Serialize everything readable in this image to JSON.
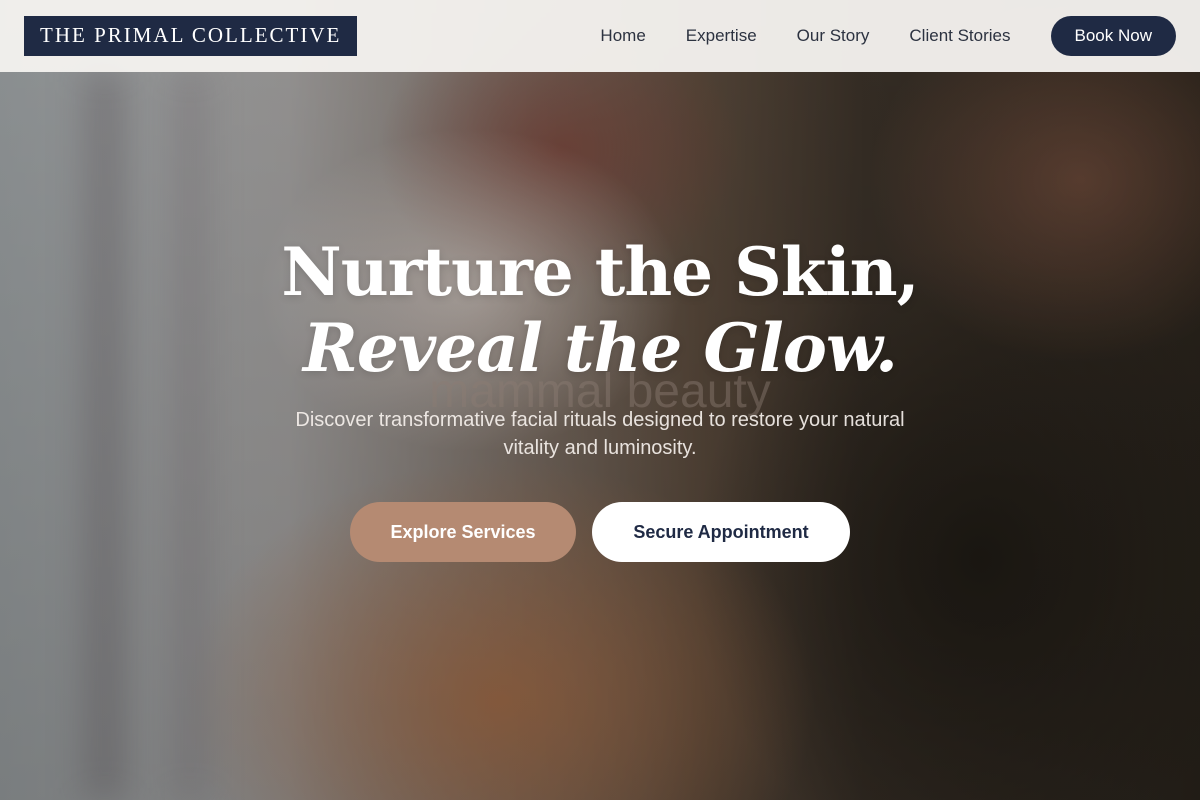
{
  "header": {
    "logo": "THE PRIMAL COLLECTIVE",
    "nav": [
      {
        "label": "Home"
      },
      {
        "label": "Expertise"
      },
      {
        "label": "Our Story"
      },
      {
        "label": "Client Stories"
      }
    ],
    "cta_label": "Book Now"
  },
  "hero": {
    "headline_line1": "Nurture the Skin,",
    "headline_line2": "Reveal the Glow.",
    "watermark": "mammal beauty",
    "subtitle": "Discover transformative facial rituals designed to restore your natural vitality and luminosity.",
    "primary_cta": "Explore Services",
    "secondary_cta": "Secure Appointment"
  },
  "colors": {
    "navy": "#1f2a44",
    "accent": "#b58a72",
    "header_bg": "#f4f1ee"
  }
}
